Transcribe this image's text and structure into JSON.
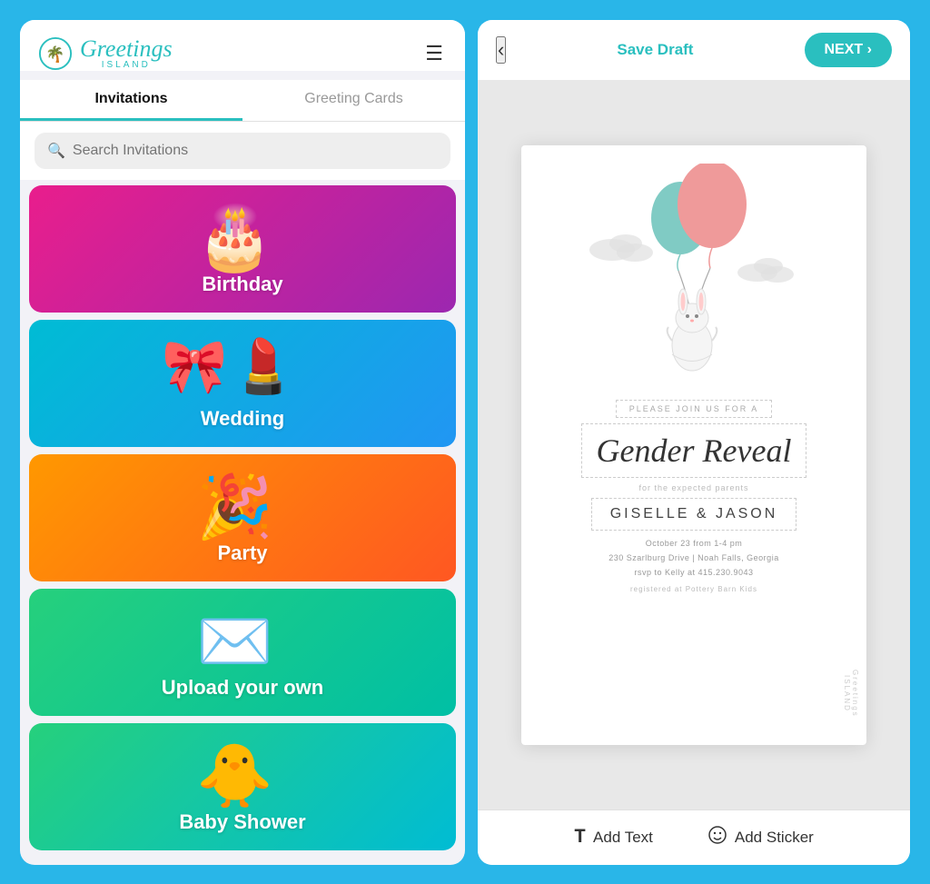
{
  "app": {
    "logo_greetings": "Greetings",
    "logo_island": "ISLAND"
  },
  "tabs": {
    "tab1_label": "Invitations",
    "tab2_label": "Greeting Cards"
  },
  "search": {
    "placeholder": "Search Invitations"
  },
  "categories": [
    {
      "id": "birthday",
      "label": "Birthday",
      "emoji": "🎂",
      "class": "card-birthday"
    },
    {
      "id": "wedding",
      "label": "Wedding",
      "emoji": "🎀",
      "class": "card-wedding"
    },
    {
      "id": "party",
      "label": "Party",
      "emoji": "🎉",
      "class": "card-party"
    },
    {
      "id": "upload",
      "label": "Upload your own",
      "emoji": "✉️",
      "class": "card-upload"
    },
    {
      "id": "baby",
      "label": "Baby Shower",
      "emoji": "🐥",
      "class": "card-baby"
    }
  ],
  "editor": {
    "back_label": "‹",
    "save_draft_label": "Save Draft",
    "next_label": "NEXT ›"
  },
  "invitation": {
    "please_join": "PLEASE JOIN US FOR A",
    "title": "Gender Reveal",
    "expected_parents": "for the expected parents",
    "names": "GISELLE & JASON",
    "date_line": "October 23 from 1-4 pm",
    "address_line": "230 Szarlburg Drive | Noah Falls, Georgia",
    "rsvp_line": "rsvp to Kelly at 415.230.9043",
    "registered_text": "registered at Pottery Barn Kids"
  },
  "toolbar": {
    "add_text_label": "Add Text",
    "add_sticker_label": "Add Sticker"
  }
}
